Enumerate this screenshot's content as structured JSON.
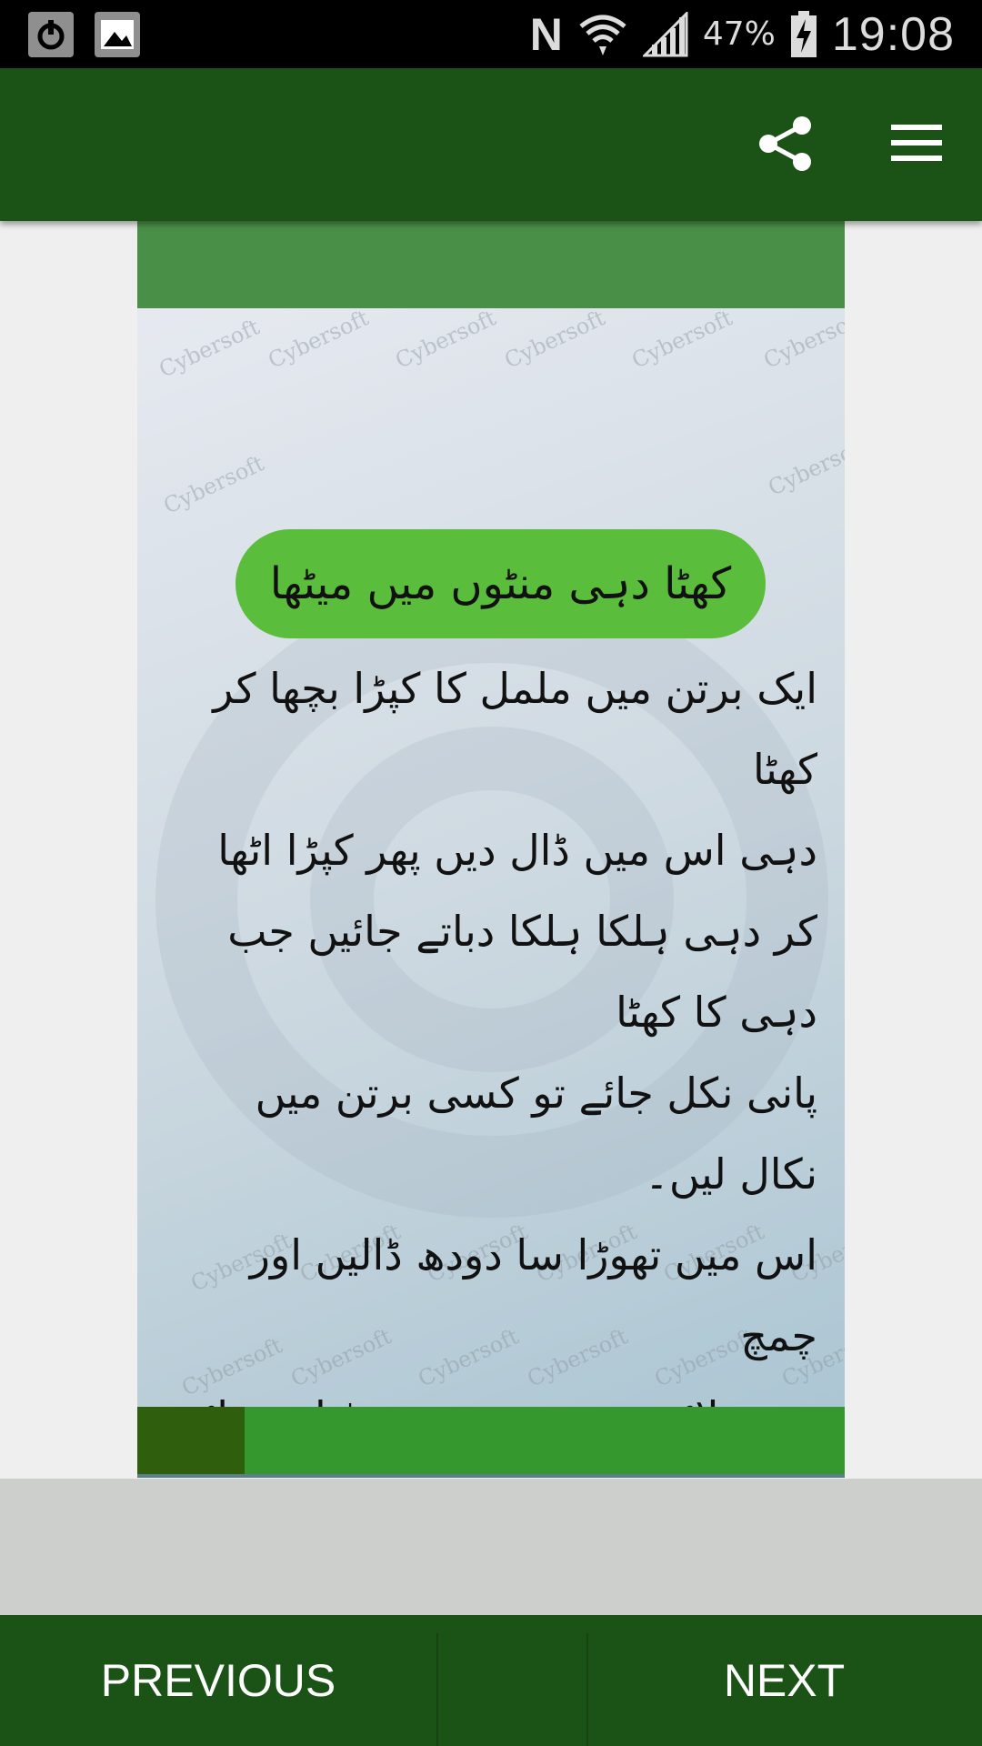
{
  "status_bar": {
    "left_icons": [
      "power-icon",
      "image-icon"
    ],
    "right_icons": [
      "nfc-icon",
      "wifi-icon",
      "signal-icon",
      "battery-charging-icon"
    ],
    "battery": "47%",
    "time": "19:08"
  },
  "app_bar": {
    "icons": [
      "share-icon",
      "menu-icon"
    ],
    "color": "#1b5215"
  },
  "card": {
    "title": "کھٹا دہی منٹوں میں میٹھا",
    "watermark": "Cybersoft",
    "lines": [
      "ایک برتن میں ململ کا کپڑا بچھا کر کھٹا",
      "دہی اس میں ڈال دیں پھر کپڑا اٹھا",
      "کر دہی ہلکا ہلکا دباتے جائیں جب دہی کا کھٹا",
      "پانی نکل جائے تو کسی برتن میں نکال لیں۔",
      "اس میں تھوڑا سا دودھ ڈالیں اور چمچ",
      "سے ہلائیں دہی پھر سے میٹھا ہوجائے گا۔"
    ],
    "accent_color": "#5bbd3c"
  },
  "navigation": {
    "previous_label": "PREVIOUS",
    "next_label": "NEXT"
  }
}
